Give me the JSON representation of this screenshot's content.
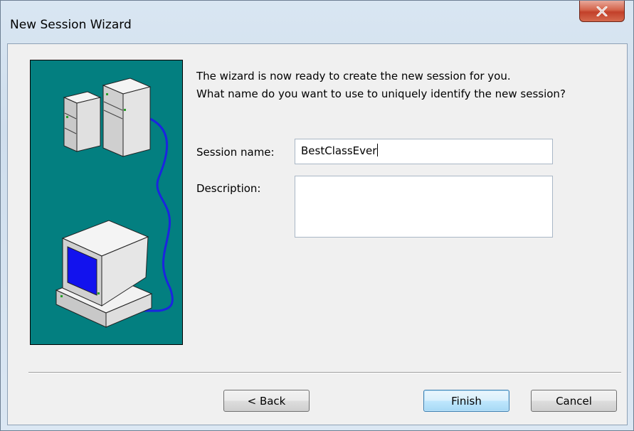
{
  "window": {
    "title": "New Session Wizard",
    "close_icon": "close-icon"
  },
  "illustration": {
    "icon": "server-to-computer-network-icon",
    "background_color": "#037f80"
  },
  "message": {
    "line1": "The wizard is now ready to create the new session for you.",
    "line2": "What name do you want to use to uniquely identify the new session?"
  },
  "form": {
    "session_name_label": "Session name:",
    "session_name_value": "BestClassEver",
    "description_label": "Description:",
    "description_value": ""
  },
  "buttons": {
    "back": "< Back",
    "finish": "Finish",
    "cancel": "Cancel"
  }
}
